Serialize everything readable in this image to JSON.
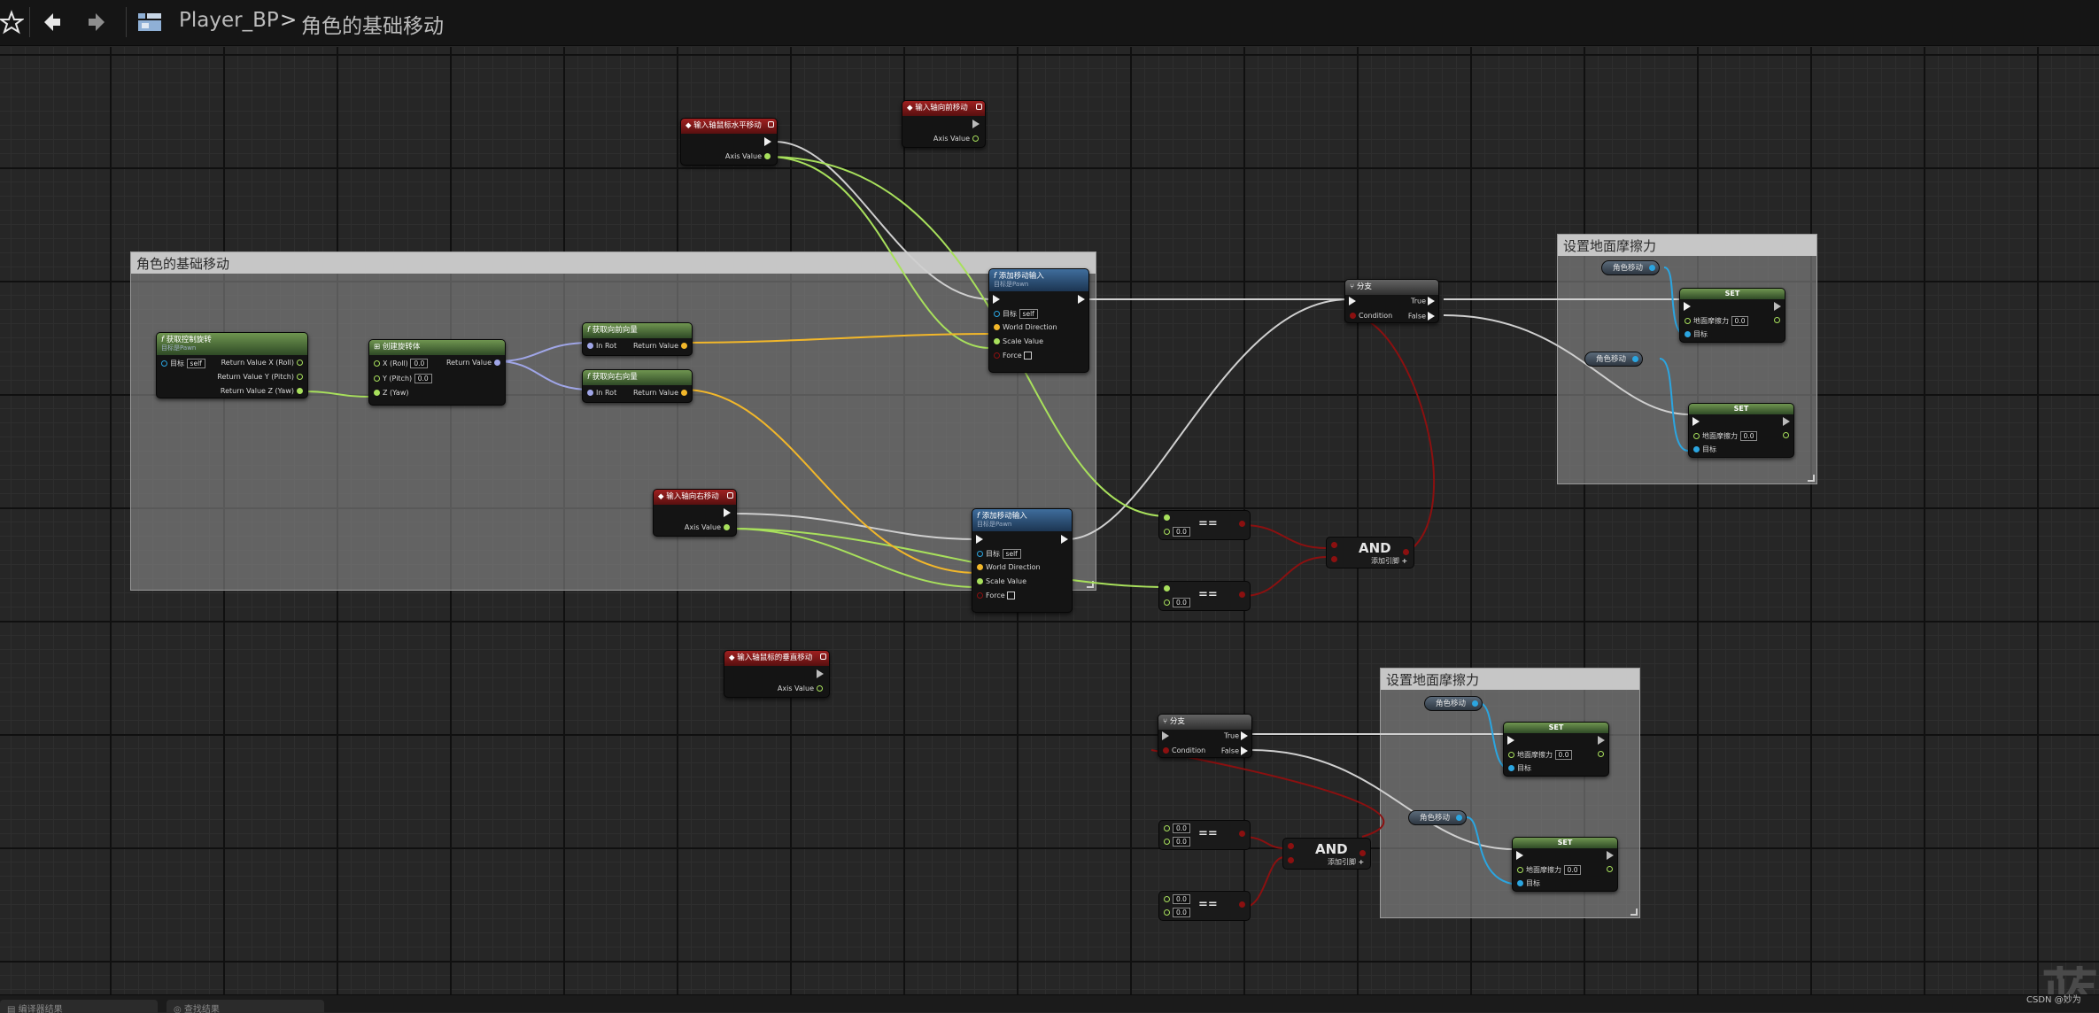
{
  "toolbar": {
    "favorite_icon": "star-icon",
    "back_icon": "back-arrow-icon",
    "forward_icon": "forward-arrow-icon",
    "graph_icon": "blueprint-graph-icon",
    "breadcrumb_blueprint": "Player_BP",
    "breadcrumb_separator": ">",
    "breadcrumb_graph": "角色的基础移动"
  },
  "comments": {
    "main": "角色的基础移动",
    "friction_top": "设置地面摩擦力",
    "friction_bottom": "设置地面摩擦力"
  },
  "events": {
    "move_right_top": {
      "title": "输入轴鼠标水平移动",
      "pin_value": "Axis Value"
    },
    "move_forward_top": {
      "title": "输入轴向前移动",
      "pin_value": "Axis Value"
    },
    "move_right": {
      "title": "输入轴向右移动",
      "pin_value": "Axis Value"
    },
    "mouse_vertical": {
      "title": "输入轴鼠标的垂直移动",
      "pin_value": "Axis Value"
    }
  },
  "nodes": {
    "get_control_rotation": {
      "title": "获取控制旋转",
      "subtitle": "目标是Pawn",
      "target_label": "目标",
      "target_value": "self",
      "out_x": "Return Value X (Roll)",
      "out_y": "Return Value Y (Pitch)",
      "out_z": "Return Value Z (Yaw)"
    },
    "make_rotator": {
      "title": "创建旋转体",
      "x_label": "X (Roll)",
      "x_value": "0.0",
      "y_label": "Y (Pitch)",
      "y_value": "0.0",
      "z_label": "Z (Yaw)",
      "out": "Return Value"
    },
    "get_forward": {
      "title": "获取向前向量",
      "in": "In Rot",
      "out": "Return Value"
    },
    "get_right": {
      "title": "获取向右向量",
      "in": "In Rot",
      "out": "Return Value"
    },
    "add_move_top": {
      "title": "添加移动输入",
      "subtitle": "目标是Pawn",
      "target_label": "目标",
      "target_value": "self",
      "world_direction": "World Direction",
      "scale_value": "Scale Value",
      "force": "Force"
    },
    "add_move_bottom": {
      "title": "添加移动输入",
      "subtitle": "目标是Pawn",
      "target_label": "目标",
      "target_value": "self",
      "world_direction": "World Direction",
      "scale_value": "Scale Value",
      "force": "Force"
    },
    "branch_top": {
      "title": "分支",
      "true_label": "True",
      "condition_label": "Condition",
      "false_label": "False"
    },
    "branch_bottom": {
      "title": "分支",
      "true_label": "True",
      "condition_label": "Condition",
      "false_label": "False"
    },
    "eq_value": "0.0",
    "eq_symbol": "==",
    "and_label": "AND",
    "add_pin_label": "添加引脚",
    "add_pin_symbol": "+",
    "var_label": "角色移动",
    "set_title": "SET",
    "set_friction_label": "地面摩擦力",
    "set_friction_value": "0.0",
    "set_target_label": "目标"
  },
  "watermark": "蓝",
  "credit": "CSDN @妙为",
  "bottom_tabs": [
    "编译器结果",
    "查找结果"
  ],
  "colors": {
    "exec": "#f0f0f0",
    "float": "#a8e05c",
    "vector": "#f2b72a",
    "rotator": "#a0a6e8",
    "object": "#2ba5e0",
    "bool": "#8b1010",
    "event_header": "#a02020",
    "pure_header": "#6f9550",
    "func_header": "#3f6d9c"
  }
}
